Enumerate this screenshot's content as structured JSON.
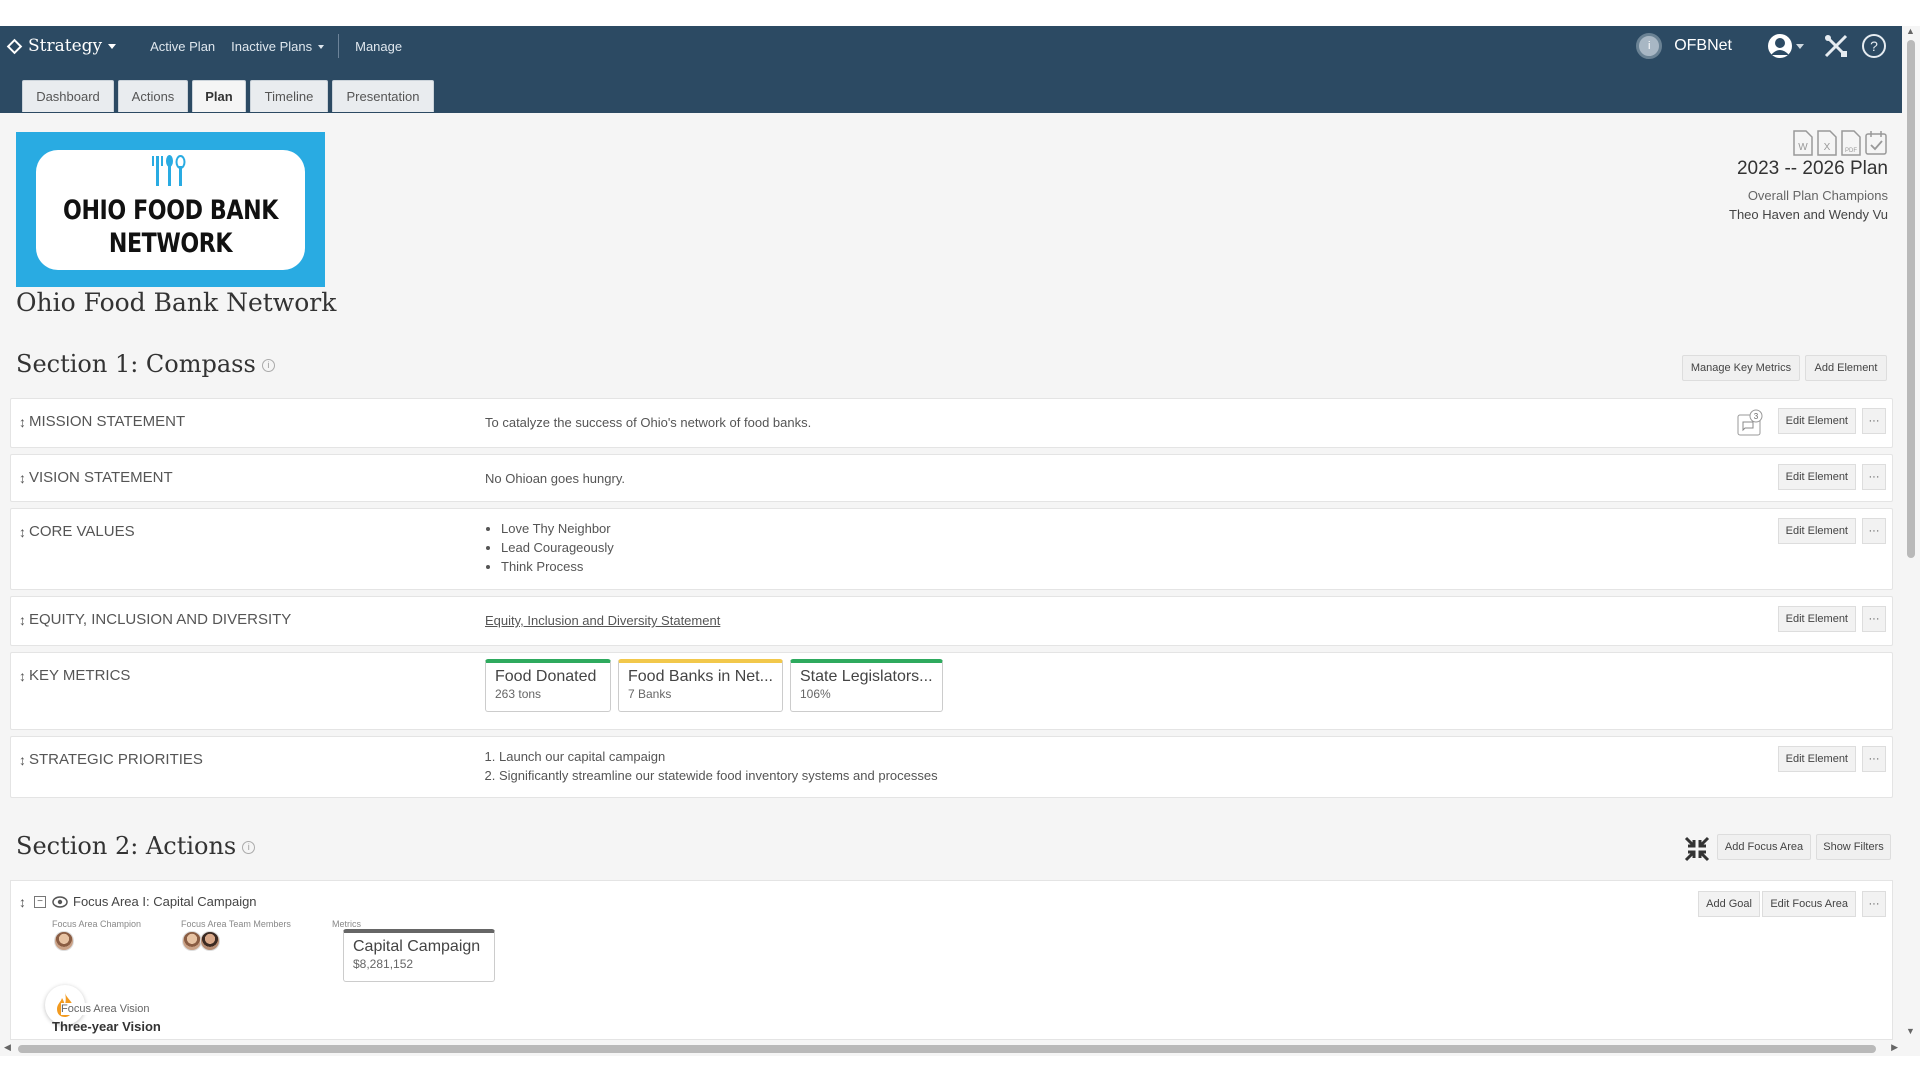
{
  "nav": {
    "brand": "Strategy",
    "links": [
      "Active Plan",
      "Inactive Plans",
      "Manage"
    ],
    "org": "OFBNet",
    "org_badge": "i"
  },
  "tabs": [
    "Dashboard",
    "Actions",
    "Plan",
    "Timeline",
    "Presentation"
  ],
  "active_tab": "Plan",
  "logo": {
    "line1": "OHIO FOOD BANK",
    "line2": "NETWORK"
  },
  "org_title": "Ohio Food Bank Network",
  "plan": {
    "years": "2023 -- 2026 Plan",
    "champions_label": "Overall Plan Champions",
    "champions": "Theo Haven and Wendy Vu"
  },
  "section1": {
    "title": "Section 1: Compass",
    "buttons": {
      "manage_metrics": "Manage Key Metrics",
      "add_element": "Add Element"
    },
    "edit_label": "Edit Element",
    "more_label": "···",
    "comment_count": "3",
    "mission": {
      "label": "MISSION STATEMENT",
      "text": "To catalyze the success of Ohio's network of food banks."
    },
    "vision": {
      "label": "VISION STATEMENT",
      "text": "No Ohioan goes hungry."
    },
    "core_values": {
      "label": "CORE VALUES",
      "items": [
        "Love Thy Neighbor",
        "Lead Courageously",
        "Think Process"
      ]
    },
    "equity": {
      "label": "EQUITY, INCLUSION AND DIVERSITY",
      "link": "Equity, Inclusion and Diversity Statement"
    },
    "key_metrics": {
      "label": "KEY METRICS",
      "cards": [
        {
          "name": "Food Donated",
          "value": "263 tons",
          "color": "#2eaa5e"
        },
        {
          "name": "Food Banks in Net...",
          "value": "7 Banks",
          "color": "#f2c84b"
        },
        {
          "name": "State Legislators...",
          "value": "106%",
          "color": "#2eaa5e"
        }
      ]
    },
    "priorities": {
      "label": "STRATEGIC PRIORITIES",
      "items": [
        "Launch our capital campaign",
        "Significantly streamline our statewide food inventory systems and processes"
      ]
    }
  },
  "section2": {
    "title": "Section 2: Actions",
    "buttons": {
      "add_focus_area": "Add Focus Area",
      "show_filters": "Show Filters"
    },
    "focus_area": {
      "title": "Focus Area I: Capital Campaign",
      "champion_label": "Focus Area Champion",
      "team_label": "Focus Area Team Members",
      "metrics_label": "Metrics",
      "metric": {
        "name": "Capital Campaign",
        "value": "$8,281,152"
      },
      "vision_label": "Focus Area Vision",
      "vision_title": "Three-year Vision",
      "buttons": {
        "add_goal": "Add Goal",
        "edit_focus_area": "Edit Focus Area",
        "more": "···"
      }
    }
  }
}
